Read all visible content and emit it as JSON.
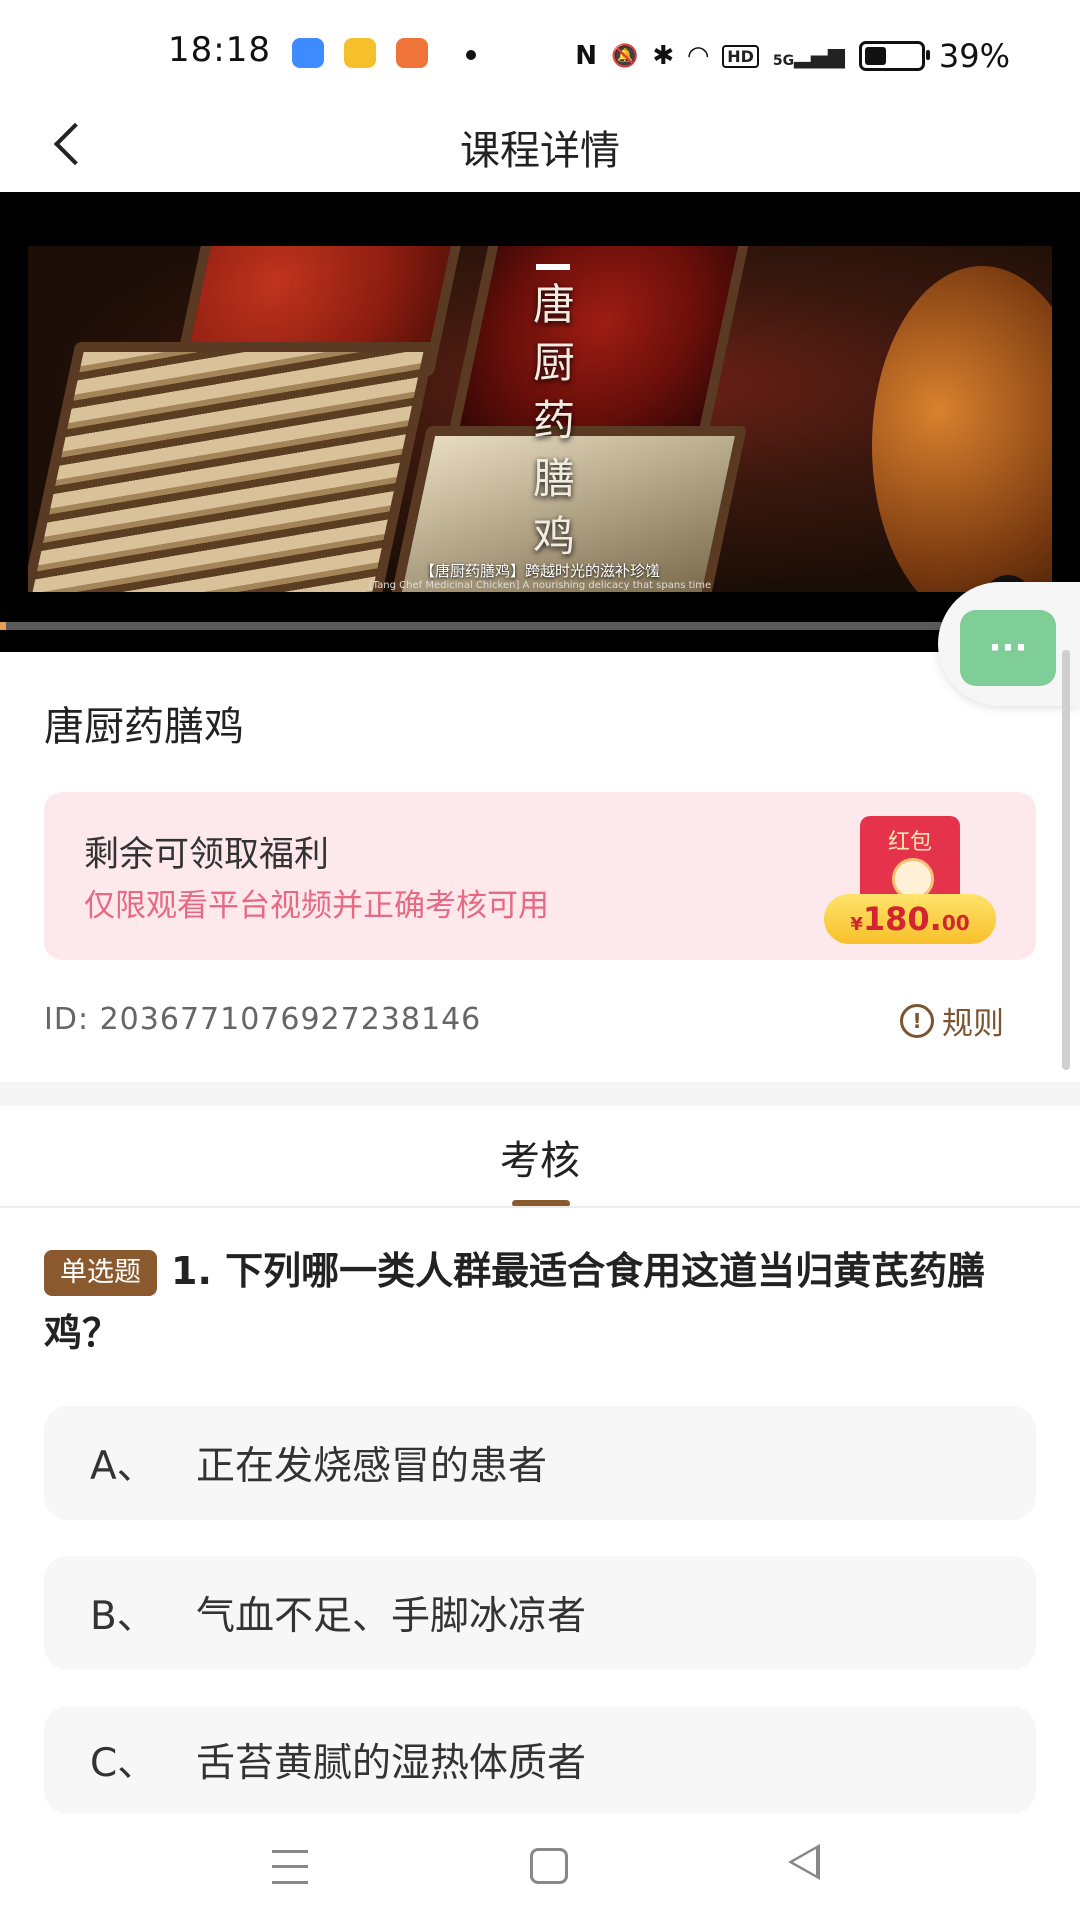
{
  "status_bar": {
    "time": "18:18",
    "app_icons": [
      {
        "name": "cloud-app-icon",
        "color": "#3d8bff"
      },
      {
        "name": "wallet-app-icon",
        "color": "#f5c02b"
      },
      {
        "name": "book-app-icon",
        "color": "#f0743a"
      }
    ],
    "nfc_glyph": "N",
    "silent_glyph": "🔕",
    "bluetooth_glyph": "✱",
    "wifi_glyph": "◠",
    "hd_label": "HD",
    "signal_label": "5G",
    "signal_glyph": "▂▄▆",
    "battery_level": 0.39,
    "battery_text": "39%"
  },
  "header": {
    "title": "课程详情",
    "back_icon": "chevron-left-icon"
  },
  "video": {
    "title_vertical": "唐\n厨\n药\n膳\n鸡",
    "subtitle_cn": "【唐厨药膳鸡】跨越时光的滋补珍馐",
    "subtitle_en": "[Tang Chef Medicinal Chicken] A nourishing delicacy that spans time",
    "progress": 0.006,
    "fullscreen_icon": "fullscreen-icon",
    "colors": {
      "progress": "#e8a055",
      "track": "#5a5a5a"
    }
  },
  "float_button": {
    "label": "···",
    "color": "#7fce98"
  },
  "course": {
    "title": "唐厨药膳鸡",
    "welfare": {
      "label": "剩余可领取福利",
      "note": "仅限观看平台视频并正确考核可用",
      "hongbao_label": "红包",
      "currency": "¥",
      "amount_int": "180.",
      "amount_dec": "00"
    },
    "id_text": "ID: 2036771076927238146",
    "rules_icon_glyph": "!",
    "rules_label": "规则"
  },
  "tab": {
    "label": "考核",
    "accent": "#8a5a2e"
  },
  "question": {
    "type_badge": "单选题",
    "text": "1. 下列哪一类人群最适合食用这道当归黄芪药膳鸡？",
    "options": [
      {
        "letter": "A、",
        "text": "正在发烧感冒的患者"
      },
      {
        "letter": "B、",
        "text": "气血不足、手脚冰凉者"
      },
      {
        "letter": "C、",
        "text": "舌苔黄腻的湿热体质者"
      }
    ]
  }
}
